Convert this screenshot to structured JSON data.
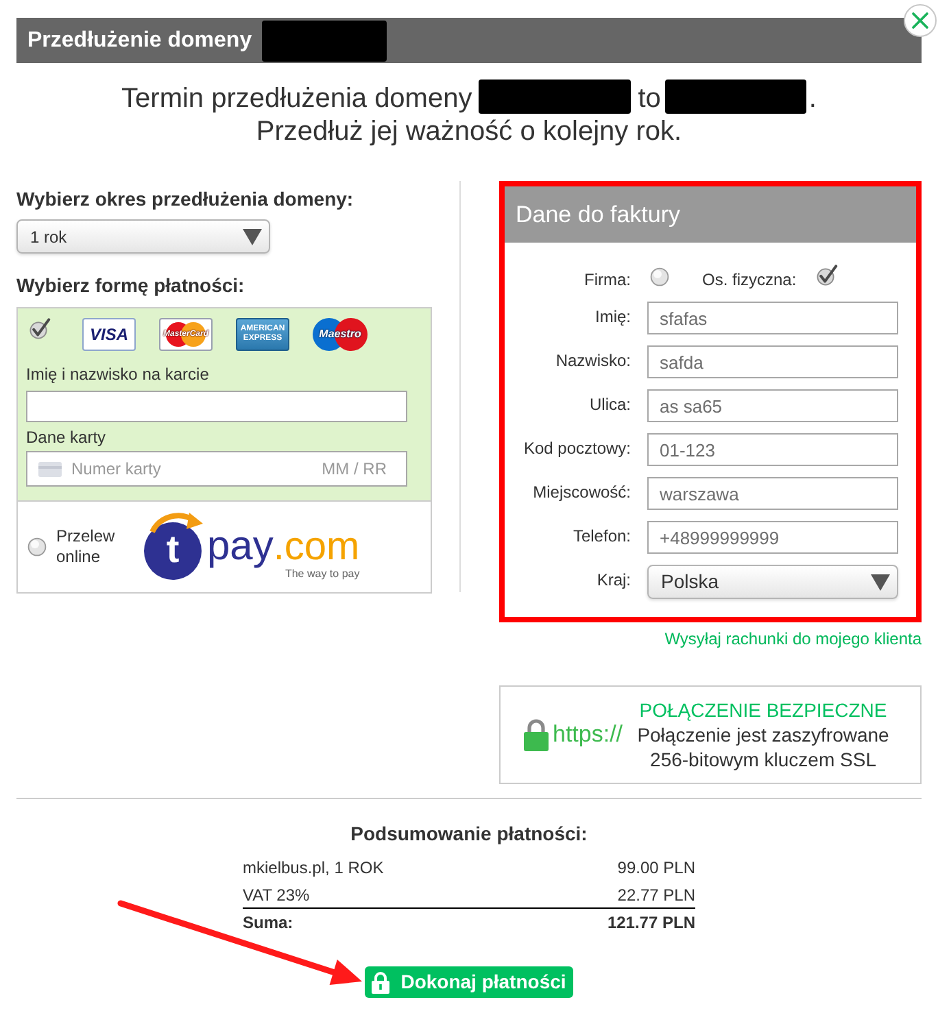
{
  "dialog": {
    "title": "Przedłużenie domeny"
  },
  "intro": {
    "line_1": [
      "Termin przedłużenia domeny",
      "to",
      "."
    ],
    "line_2": "Przedłuż jej ważność o kolejny rok."
  },
  "renewal": {
    "label": "Wybierz okres przedłużenia domeny:",
    "value": "1 rok"
  },
  "payment": {
    "label": "Wybierz formę płatności:",
    "methods": [
      {
        "kind": "card",
        "selected": true,
        "brands": [
          {
            "kind": "visa",
            "label": "VISA"
          },
          {
            "kind": "mastercard",
            "label": "MasterCard"
          },
          {
            "kind": "amex",
            "label": "AMERICAN EXPRESS"
          },
          {
            "kind": "maestro",
            "label": "Maestro"
          }
        ],
        "holder_label": "Imię i nazwisko na karcie",
        "details_label": "Dane karty",
        "number_placeholder": "Numer karty",
        "expiry_placeholder": "MM / RR"
      },
      {
        "kind": "transfer",
        "selected": false,
        "label": "Przelew online",
        "provider": {
          "mark": "t",
          "name": "pay",
          "suffix": ".com",
          "tagline": "The way to pay"
        }
      }
    ]
  },
  "invoice": {
    "title": "Dane do faktury",
    "customer_types": [
      {
        "label": "Firma:",
        "selected": false
      },
      {
        "label": "Os. fizyczna:",
        "selected": true
      }
    ],
    "fields": [
      {
        "kind": "text",
        "label": "Imię:",
        "value": "sfafas"
      },
      {
        "kind": "text",
        "label": "Nazwisko:",
        "value": "safda"
      },
      {
        "kind": "text",
        "label": "Ulica:",
        "value": "as sa65"
      },
      {
        "kind": "text",
        "label": "Kod pocztowy:",
        "value": "01-123"
      },
      {
        "kind": "text",
        "label": "Miejscowość:",
        "value": "warszawa"
      },
      {
        "kind": "text",
        "label": "Telefon:",
        "value": "+48999999999"
      },
      {
        "kind": "select",
        "label": "Kraj:",
        "value": "Polska"
      }
    ],
    "link": "Wysyłaj rachunki do mojego klienta"
  },
  "secure_connection": {
    "scheme": "https://",
    "title": "POŁĄCZENIE BEZPIECZNE",
    "lines": [
      "Połączenie jest zaszyfrowane",
      "256-bitowym kluczem SSL"
    ]
  },
  "summary": {
    "title": "Podsumowanie płatności:",
    "rows": [
      {
        "kind": "item",
        "label": "mkielbus.pl, 1 ROK",
        "amount": "99.00 PLN"
      },
      {
        "kind": "item",
        "label": "VAT 23%",
        "amount": "22.77 PLN"
      },
      {
        "kind": "total",
        "label": "Suma:",
        "amount": "121.77 PLN"
      }
    ]
  },
  "pay_button": {
    "label": "Dokonaj płatności"
  }
}
